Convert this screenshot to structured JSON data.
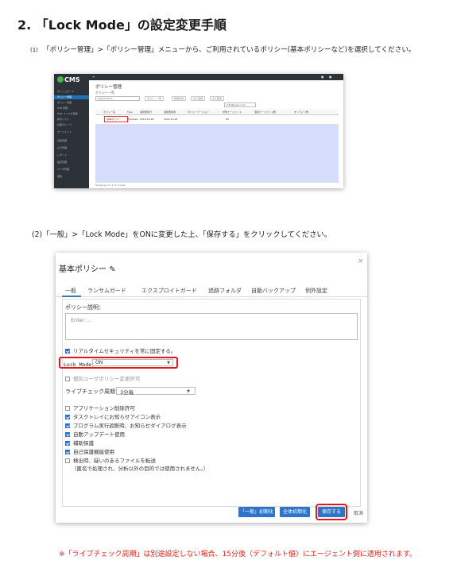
{
  "heading": "2. 「Lock Mode」の設定変更手順",
  "step1": {
    "number": "(1)",
    "text": "「ポリシー管理」>「ポリシー管理」メニューから、ご利用されているポリシー(基本ポリシーなど)を選択してください。"
  },
  "cms": {
    "logo": "CMS",
    "sidebar": [
      "ダッシュボード",
      "ポリシー管理",
      "ポリシー管理",
      "USB 管理",
      "Web フィルタ管理",
      "許可リスト",
      "社員グループ",
      "エージェント",
      "資産管理",
      "ログ管理",
      "レポート",
      "設定管理",
      "ユーザ管理",
      "通知"
    ],
    "page_title": "ポリシー管理",
    "sub_title": "ポリシー一覧",
    "select_value": "Select Items",
    "toolbar_buttons": [
      "ポリシー一覧",
      "新規作成",
      "全て適用",
      "全て削除"
    ],
    "search_value": "info@jpsec.com",
    "columns": [
      "ポリシー名",
      "Type",
      "最終更新日",
      "最終更新者",
      "ポリシーバージョン",
      "対象エージェント",
      "適用エージェント数",
      "オンライン数"
    ],
    "row": {
      "name": "基本ポリシー",
      "type": "Windows",
      "created": "2019-10-28",
      "updated": "2019-10-28",
      "count": "60"
    },
    "footer": "Showing 1 to 1 of 1 rows"
  },
  "step2": {
    "text": "(2)「一般」>「Lock Mode」をONに変更した上、「保存する」をクリックしてください。"
  },
  "dialog": {
    "title": "基本ポリシー",
    "close": "×",
    "tabs": [
      "一般",
      "ランサムガード",
      "エクスプロイトガード",
      "追跡フォルダ",
      "自動バックアップ",
      "例外設定"
    ],
    "description_label": "ポリシー説明：",
    "description_placeholder": "Enter ...",
    "realtime_label": "リアルタイムセキュリティを常に固定する。",
    "lock_mode_label": "Lock Mode：",
    "lock_mode_value": "ON",
    "individual_user_label": "個別ユーザポリシー変更許可",
    "live_check_label": "ライブチェック周期：",
    "live_check_value": "3分毎",
    "options": [
      {
        "label": "アプリケーション削除許可",
        "checked": false
      },
      {
        "label": "タスクトレイにお知らせアイコン表示",
        "checked": true
      },
      {
        "label": "プログラム実行遮断時、お知らせダイアログ表示",
        "checked": true
      },
      {
        "label": "自動アップデート使用",
        "checked": true
      },
      {
        "label": "補助保護",
        "checked": true
      },
      {
        "label": "自己保護機能使用",
        "checked": true
      },
      {
        "label": "検出時、疑いのあるファイルを転送",
        "checked": false
      }
    ],
    "option_note": "（匿名で処理され、分析以外の目的では使用されません。）",
    "buttons": {
      "reset_general": "「一般」初期化",
      "reset_all": "全体初期化",
      "save": "保存する",
      "cancel": "取消"
    }
  },
  "footnote": "※「ライブチェック周期」は別途設定しない場合、15分後（デフォルト値）にエージェント側に適用されます。"
}
